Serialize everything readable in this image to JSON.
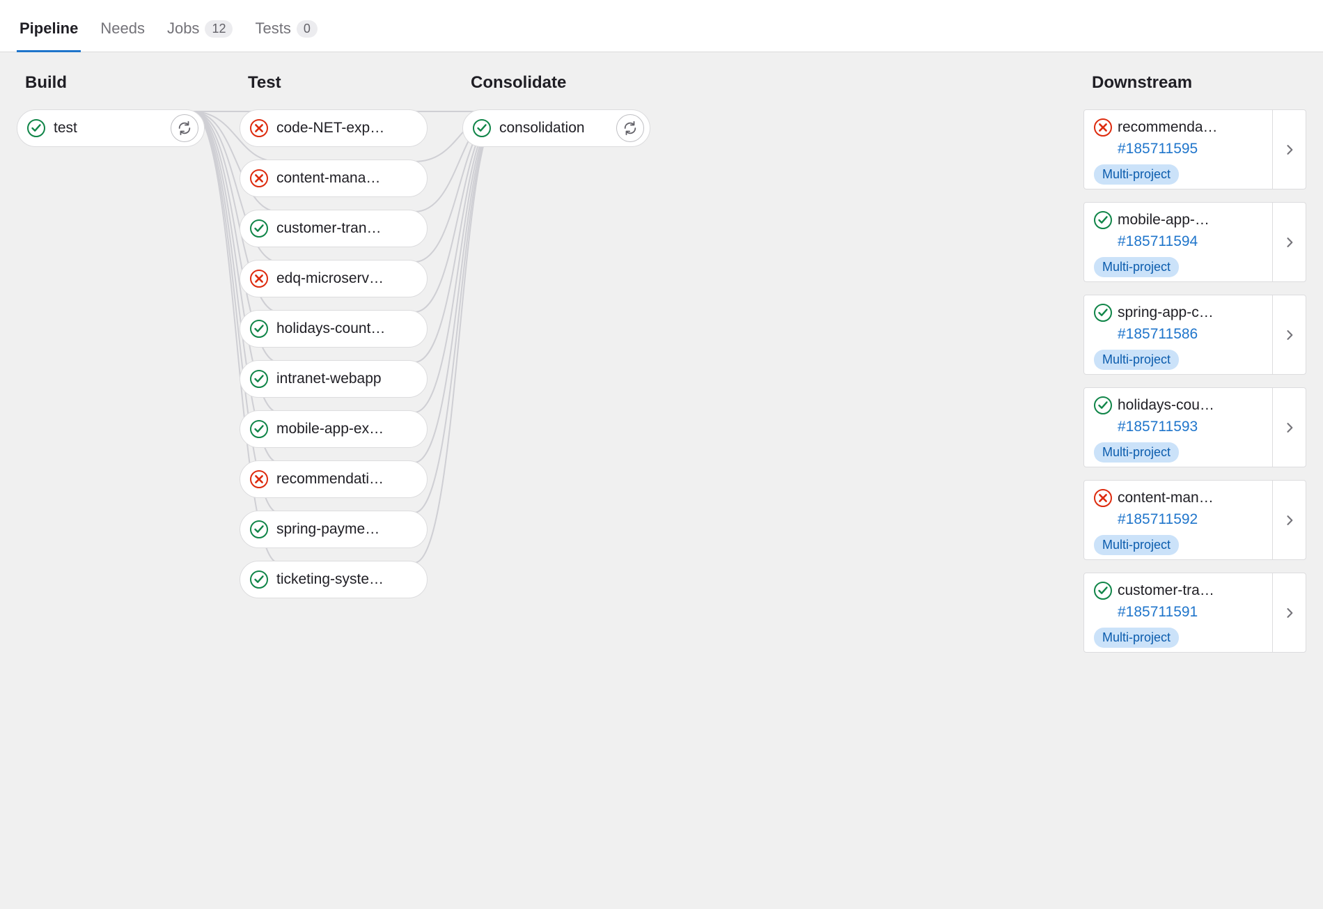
{
  "tabs": [
    {
      "label": "Pipeline",
      "active": true
    },
    {
      "label": "Needs"
    },
    {
      "label": "Jobs",
      "badge": "12"
    },
    {
      "label": "Tests",
      "badge": "0"
    }
  ],
  "stages": {
    "build": {
      "title": "Build",
      "jobs": [
        {
          "name": "test",
          "status": "passed",
          "retry": true
        }
      ]
    },
    "test": {
      "title": "Test",
      "jobs": [
        {
          "name": "code-NET-exp…",
          "status": "failed"
        },
        {
          "name": "content-mana…",
          "status": "failed"
        },
        {
          "name": "customer-tran…",
          "status": "passed"
        },
        {
          "name": "edq-microserv…",
          "status": "failed"
        },
        {
          "name": "holidays-count…",
          "status": "passed"
        },
        {
          "name": "intranet-webapp",
          "status": "passed"
        },
        {
          "name": "mobile-app-ex…",
          "status": "passed"
        },
        {
          "name": "recommendati…",
          "status": "failed"
        },
        {
          "name": "spring-payme…",
          "status": "passed"
        },
        {
          "name": "ticketing-syste…",
          "status": "passed"
        }
      ]
    },
    "consolidate": {
      "title": "Consolidate",
      "jobs": [
        {
          "name": "consolidation",
          "status": "passed",
          "retry": true
        }
      ]
    },
    "downstream": {
      "title": "Downstream",
      "items": [
        {
          "name": "recommenda…",
          "status": "failed",
          "pipeline": "#185711595",
          "badge": "Multi-project"
        },
        {
          "name": "mobile-app-…",
          "status": "passed",
          "pipeline": "#185711594",
          "badge": "Multi-project"
        },
        {
          "name": "spring-app-c…",
          "status": "passed",
          "pipeline": "#185711586",
          "badge": "Multi-project"
        },
        {
          "name": "holidays-cou…",
          "status": "passed",
          "pipeline": "#185711593",
          "badge": "Multi-project"
        },
        {
          "name": "content-man…",
          "status": "failed",
          "pipeline": "#185711592",
          "badge": "Multi-project"
        },
        {
          "name": "customer-tra…",
          "status": "passed",
          "pipeline": "#185711591",
          "badge": "Multi-project"
        }
      ]
    }
  }
}
